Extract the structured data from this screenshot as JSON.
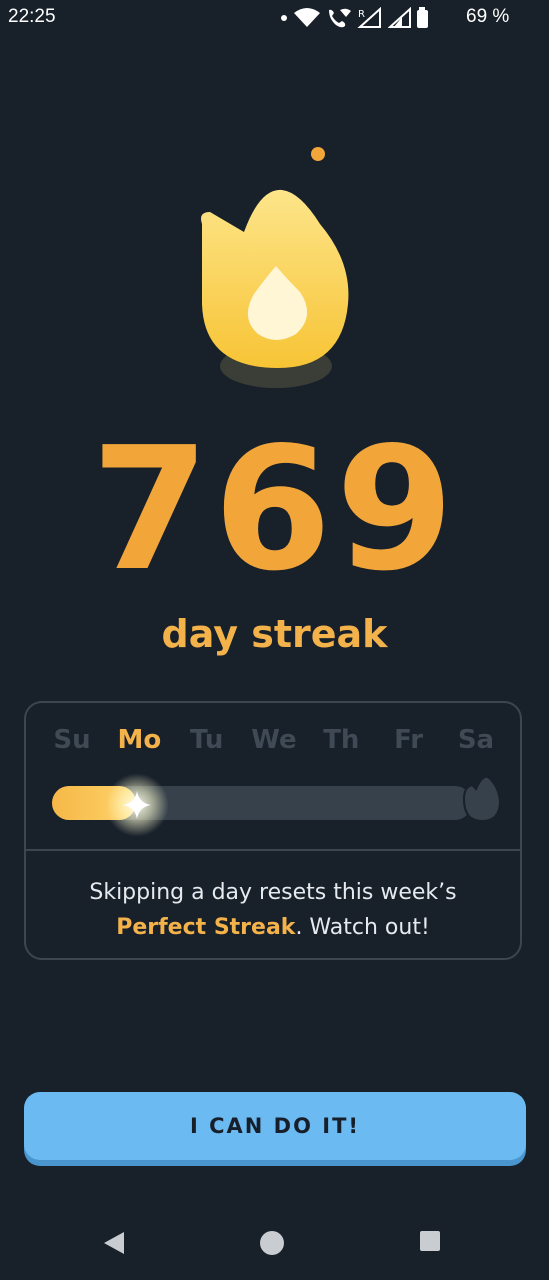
{
  "status_bar": {
    "time": "22:25",
    "battery_text": "69 %",
    "icons": [
      "dot-icon",
      "wifi-icon",
      "phone-wifi-icon",
      "signal-roaming-icon",
      "signal-icon",
      "battery-icon"
    ]
  },
  "streak": {
    "count": "769",
    "label": "day streak"
  },
  "week": {
    "days": [
      {
        "label": "Su",
        "active": false
      },
      {
        "label": "Mo",
        "active": true
      },
      {
        "label": "Tu",
        "active": false
      },
      {
        "label": "We",
        "active": false
      },
      {
        "label": "Th",
        "active": false
      },
      {
        "label": "Fr",
        "active": false
      },
      {
        "label": "Sa",
        "active": false
      }
    ],
    "progress_fraction": 0.2,
    "warning_before": "Skipping a day resets this week’s ",
    "warning_highlight": "Perfect Streak",
    "warning_after": ". Watch out!"
  },
  "cta": {
    "label": "I CAN DO IT!"
  },
  "colors": {
    "background": "#18202a",
    "accent_orange": "#f4b24a",
    "button_blue": "#6bbbf2"
  },
  "nav": {
    "icons": [
      "back-icon",
      "home-icon",
      "recents-icon"
    ]
  }
}
